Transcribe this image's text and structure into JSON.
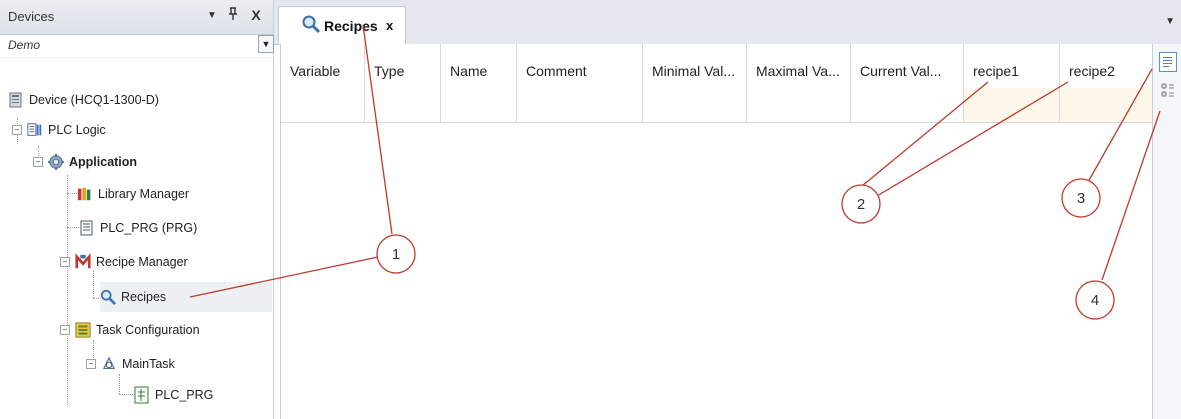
{
  "devices": {
    "title": "Devices",
    "pin_icon": "pin-icon",
    "close_icon": "close-icon",
    "project": "Demo",
    "tree": [
      {
        "label": "Device (HCQ1-1300-D)",
        "icon": "device-icon",
        "bold": false
      },
      {
        "label": "PLC Logic",
        "icon": "plc-logic-icon",
        "bold": false
      },
      {
        "label": "Application",
        "icon": "application-gear-icon",
        "bold": true
      },
      {
        "label": "Library Manager",
        "icon": "library-books-icon",
        "bold": false
      },
      {
        "label": "PLC_PRG (PRG)",
        "icon": "program-document-icon",
        "bold": false
      },
      {
        "label": "Recipe Manager",
        "icon": "recipe-manager-icon",
        "bold": false
      },
      {
        "label": "Recipes",
        "icon": "magnifier-icon",
        "bold": false,
        "selected": true
      },
      {
        "label": "Task Configuration",
        "icon": "task-configuration-icon",
        "bold": false
      },
      {
        "label": "MainTask",
        "icon": "task-icon",
        "bold": false
      },
      {
        "label": "PLC_PRG",
        "icon": "program-call-icon",
        "bold": false
      }
    ]
  },
  "editor": {
    "tab_label": "Recipes",
    "tab_close": "x",
    "columns": [
      "Variable",
      "Type",
      "Name",
      "Comment",
      "Minimal Val...",
      "Maximal Va...",
      "Current Val...",
      "recipe1",
      "recipe2"
    ]
  },
  "toolbar": {
    "list_view_icon": "list-view-icon",
    "properties_icon": "properties-icon"
  },
  "callouts": [
    "1",
    "2",
    "3",
    "4"
  ],
  "colors": {
    "callout": "#c0392b",
    "recipe_column_fill": "#fff8ea",
    "panel_header": "#dde2ea"
  }
}
